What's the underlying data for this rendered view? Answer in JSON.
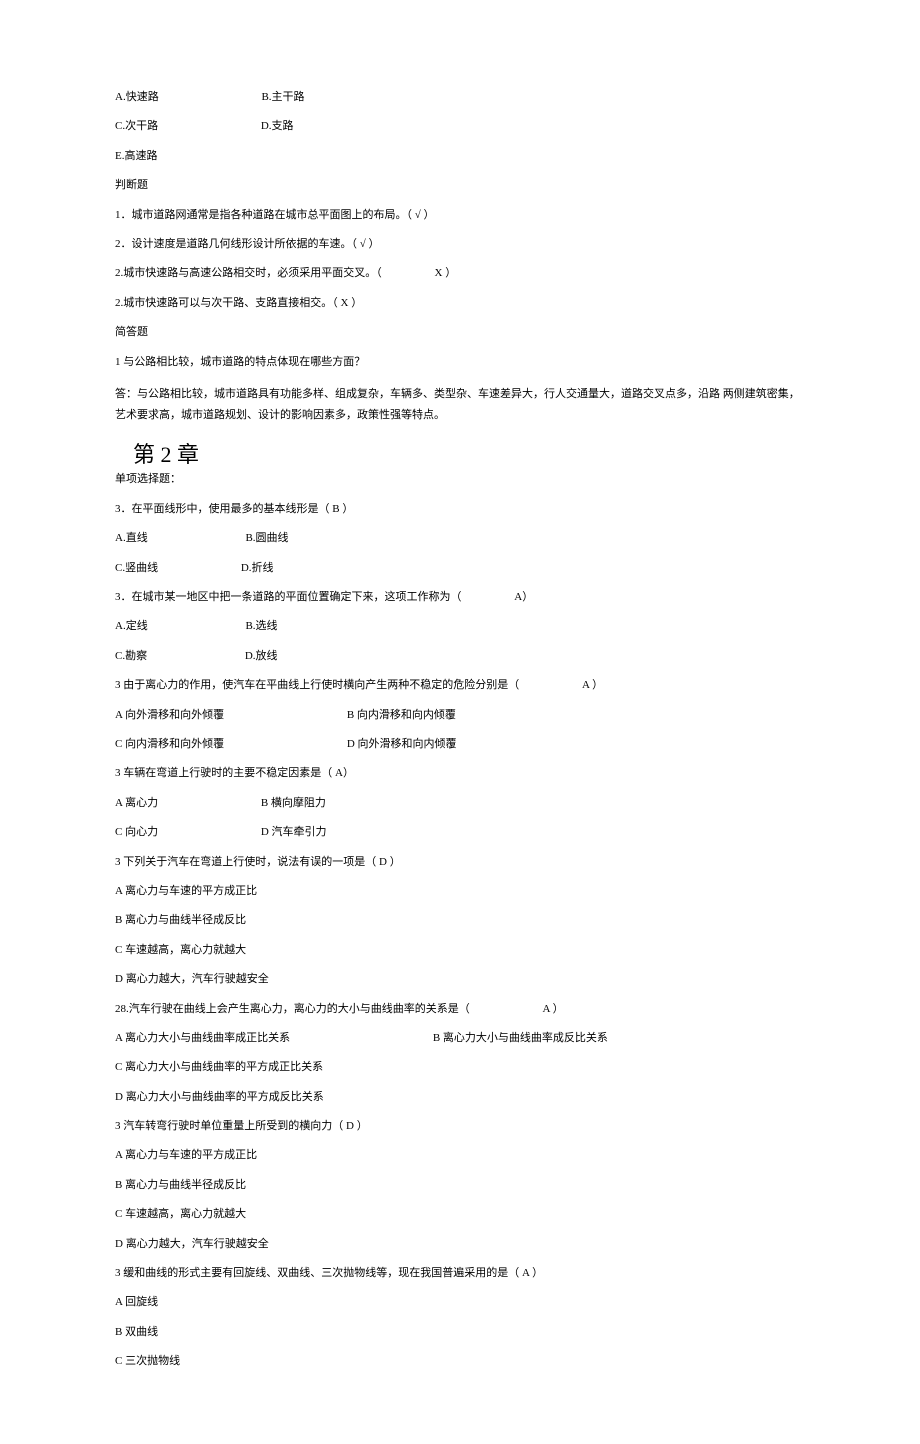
{
  "top_options": {
    "a": "A.快速路",
    "b": "B.主干路",
    "c": "C.次干路",
    "d": "D.支路",
    "e": "E.高速路"
  },
  "judge_header": "判断题",
  "judge": {
    "j1": "1．城市道路网通常是指各种道路在城市总平面图上的布局。（ √ ）",
    "j2": "2．设计速度是道路几何线形设计所依据的车速。（ √ ）",
    "j3": "2.城市快速路与高速公路相交时，必须采用平面交叉。（",
    "j3b": "X ）",
    "j4": "2.城市快速路可以与次干路、支路直接相交。（ X ）"
  },
  "short_header": "简答题",
  "short": {
    "q1": "1 与公路相比较，城市道路的特点体现在哪些方面？",
    "a1": "答：与公路相比较，城市道路具有功能多样、组成复杂，车辆多、类型杂、车速差异大，行人交通量大，道路交叉点多，沿路 两侧建筑密集，艺术要求高，城市道路规划、设计的影响因素多，政策性强等特点。"
  },
  "chapter2": "第 2 章",
  "mc_header": "单项选择题：",
  "q": {
    "q3": "3．在平面线形中，使用最多的基本线形是（ B ）",
    "q3a": "A.直线",
    "q3b": "B.圆曲线",
    "q3c": "C.竖曲线",
    "q3d": "D.折线",
    "q4": "3．在城市某一地区中把一条道路的平面位置确定下来，这项工作称为（",
    "q4ans": "A）",
    "q4a": "A.定线",
    "q4b": "B.选线",
    "q4c": "C.勘察",
    "q4d": "D.放线",
    "q5": "3 由于离心力的作用，使汽车在平曲线上行使时横向产生两种不稳定的危险分别是（",
    "q5ans": "A ）",
    "q5a": "A 向外滑移和向外倾覆",
    "q5b": "B 向内滑移和向内倾覆",
    "q5c": "C 向内滑移和向外倾覆",
    "q5d": "D 向外滑移和向内倾覆",
    "q6": "3 车辆在弯道上行驶时的主要不稳定因素是（ A）",
    "q6a": "A 离心力",
    "q6b": "B 横向摩阻力",
    "q6c": "C 向心力",
    "q6d": "D 汽车牵引力",
    "q7": "3 下列关于汽车在弯道上行使时，说法有误的一项是（ D ）",
    "q7a": "A 离心力与车速的平方成正比",
    "q7b": "B 离心力与曲线半径成反比",
    "q7c": "C 车速越高，离心力就越大",
    "q7d": "D 离心力越大，汽车行驶越安全",
    "q8": "28.汽车行驶在曲线上会产生离心力，离心力的大小与曲线曲率的关系是（",
    "q8ans": "A ）",
    "q8a": "A 离心力大小与曲线曲率成正比关系",
    "q8b": "B 离心力大小与曲线曲率成反比关系",
    "q8c": "C 离心力大小与曲线曲率的平方成正比关系",
    "q8d": "D 离心力大小与曲线曲率的平方成反比关系",
    "q9": "3 汽车转弯行驶时单位重量上所受到的横向力（ D ）",
    "q9a": "A 离心力与车速的平方成正比",
    "q9b": "B 离心力与曲线半径成反比",
    "q9c": "C 车速越高，离心力就越大",
    "q9d": "D 离心力越大，汽车行驶越安全",
    "q10": "3 缓和曲线的形式主要有回旋线、双曲线、三次抛物线等，现在我国普遍采用的是（ A ）",
    "q10a": "A 回旋线",
    "q10b": "B 双曲线",
    "q10c": "C 三次抛物线"
  }
}
